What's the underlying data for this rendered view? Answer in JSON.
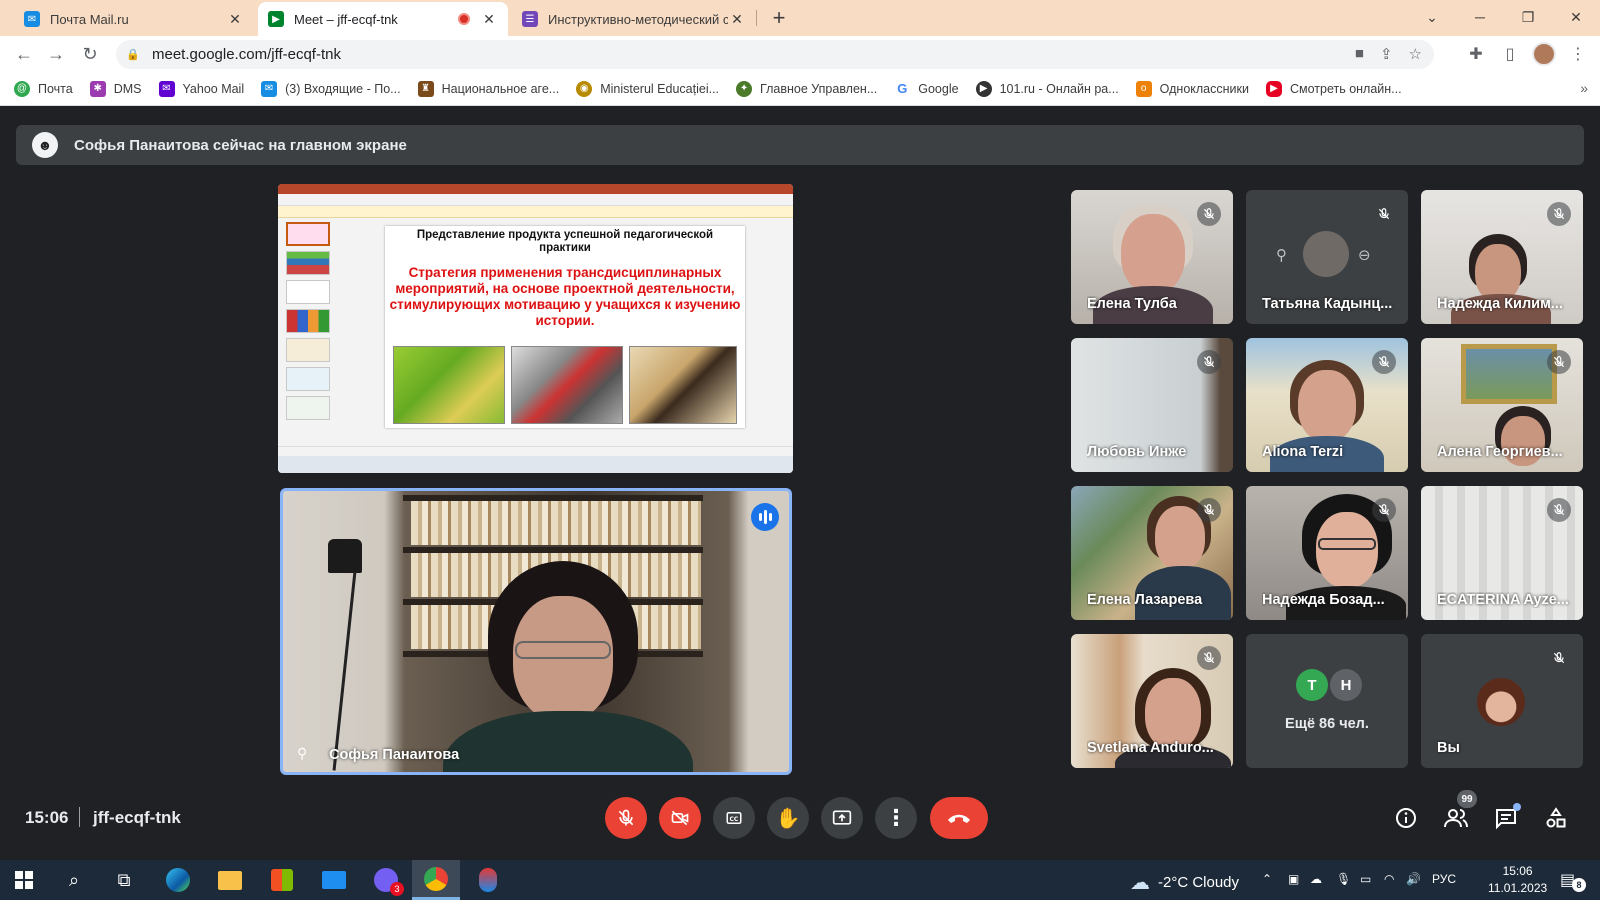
{
  "browser": {
    "tabs": [
      {
        "title": "Почта Mail.ru",
        "favicon_color": "#168de2"
      },
      {
        "title": "Meet – jff-ecqf-tnk",
        "favicon_color": "#00832d",
        "active": true,
        "recording": true
      },
      {
        "title": "Инструктивно-методический се",
        "favicon_color": "#7248b9"
      }
    ],
    "url": "meet.google.com/jff-ecqf-tnk",
    "bookmarks": [
      {
        "label": "Почта",
        "color": "#2fa84f"
      },
      {
        "label": "DMS",
        "color": "#9c3bb0"
      },
      {
        "label": "Yahoo Mail",
        "color": "#6001d2"
      },
      {
        "label": "(3) Входящие - По...",
        "color": "#168de2"
      },
      {
        "label": "Национальное аге...",
        "color": "#7a4a1a"
      },
      {
        "label": "Ministerul Educației...",
        "color": "#b88a00"
      },
      {
        "label": "Главное Управлен...",
        "color": "#4a7a2a"
      },
      {
        "label": "Google",
        "color": "#ffffff"
      },
      {
        "label": "101.ru - Онлайн ра...",
        "color": "#333333"
      },
      {
        "label": "Одноклассники",
        "color": "#ee8208"
      },
      {
        "label": "Смотреть онлайн...",
        "color": "#e60023"
      }
    ],
    "more_bookmarks": "»"
  },
  "meet": {
    "banner": "Софья Панаитова сейчас на главном экране",
    "presentation": {
      "heading": "Представление продукта успешной педагогической практики",
      "title": "Стратегия применения трансдисциплинарных мероприятий, на основе проектной деятельности, стимулирующих мотивацию у учащихся к изучению истории."
    },
    "speaker_name": "Софья Панаитова",
    "participants": [
      {
        "name": "Елена Тулба",
        "muted": true
      },
      {
        "name": "Татьяна Кадынц...",
        "muted": true,
        "avatar_only": true
      },
      {
        "name": "Надежда Килим...",
        "muted": true
      },
      {
        "name": "Любовь Инже",
        "muted": true
      },
      {
        "name": "Aliona Terzi",
        "muted": true
      },
      {
        "name": "Алена Георгиев...",
        "muted": true
      },
      {
        "name": "Елена Лазарева",
        "muted": true
      },
      {
        "name": "Надежда Бозад...",
        "muted": true
      },
      {
        "name": "ECATERINA Ayze...",
        "muted": true
      },
      {
        "name": "Svetlana Anduro...",
        "muted": true
      }
    ],
    "overflow": {
      "initials": [
        "T",
        "H"
      ],
      "initial_colors": [
        "#34a853",
        "#5f6368"
      ],
      "label": "Ещё 86 чел."
    },
    "self_tile": {
      "name": "Вы",
      "muted": true
    },
    "time": "15:06",
    "meeting_code": "jff-ecqf-tnk",
    "people_count": "99"
  },
  "taskbar": {
    "weather": "-2°C  Cloudy",
    "lang": "РУС",
    "time": "15:06",
    "date": "11.01.2023",
    "notifications": "8",
    "viber_badge": "3"
  }
}
